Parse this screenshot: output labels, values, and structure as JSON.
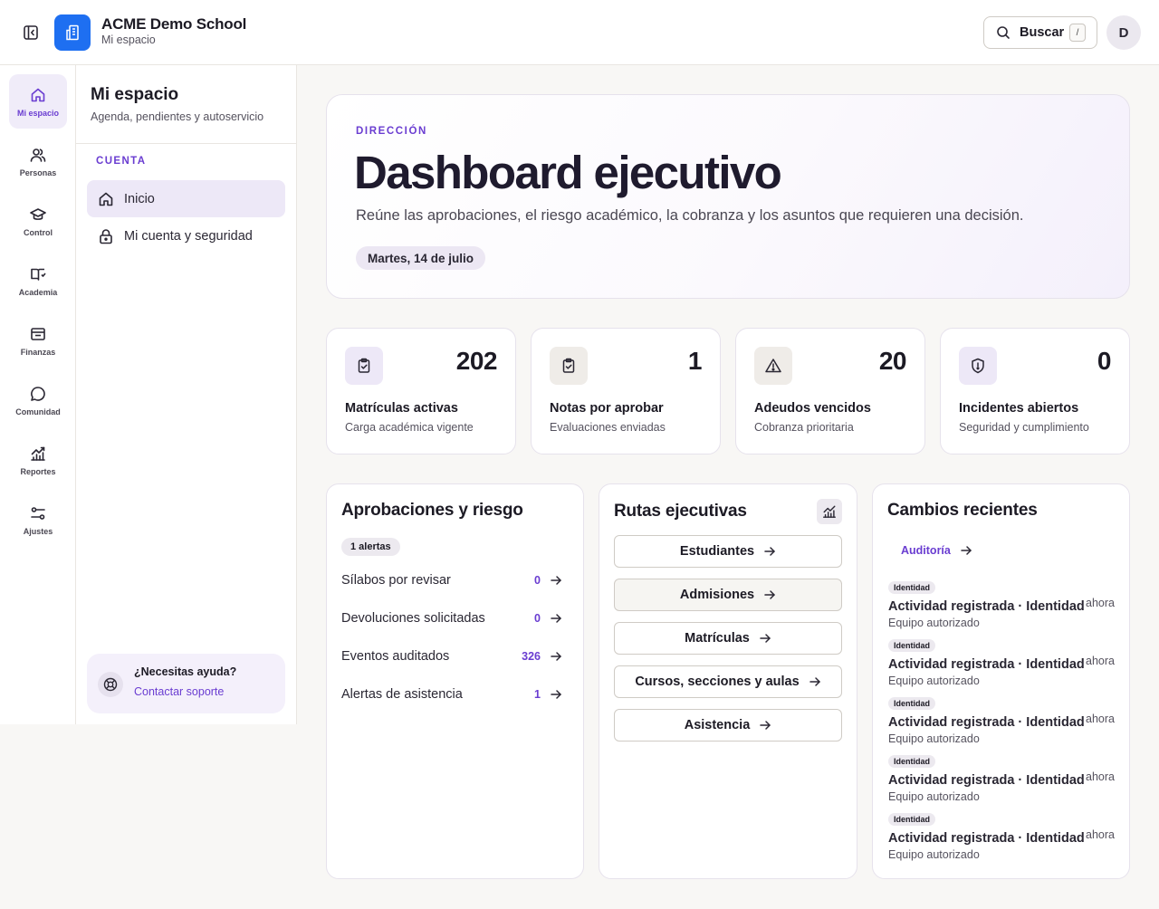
{
  "app": {
    "name": "ACME Demo School",
    "subtitle": "Mi espacio"
  },
  "search": {
    "label": "Buscar",
    "shortcut": "/"
  },
  "user": {
    "avatar_initial": "D"
  },
  "rail": [
    {
      "label": "Mi espacio",
      "icon": "home-icon",
      "active": true
    },
    {
      "label": "Personas",
      "icon": "users-icon"
    },
    {
      "label": "Control",
      "icon": "graduation-cap-icon"
    },
    {
      "label": "Academia",
      "icon": "book-icon"
    },
    {
      "label": "Finanzas",
      "icon": "wallet-icon"
    },
    {
      "label": "Comunidad",
      "icon": "chat-bubble-icon"
    },
    {
      "label": "Reportes",
      "icon": "chart-icon"
    },
    {
      "label": "Ajustes",
      "icon": "sliders-icon"
    }
  ],
  "subnav": {
    "title": "Mi espacio",
    "subtitle": "Agenda, pendientes y autoservicio",
    "section": "CUENTA",
    "items": [
      {
        "label": "Inicio",
        "icon": "home-icon",
        "active": true
      },
      {
        "label": "Mi cuenta y seguridad",
        "icon": "lock-icon"
      }
    ],
    "help": {
      "title": "¿Necesitas ayuda?",
      "link": "Contactar soporte"
    }
  },
  "hero": {
    "kicker": "DIRECCIÓN",
    "title": "Dashboard ejecutivo",
    "description": "Reúne las aprobaciones, el riesgo académico, la cobranza y los asuntos que requieren una decisión.",
    "date": "Martes, 14 de julio"
  },
  "stats": [
    {
      "value": "202",
      "label": "Matrículas activas",
      "sub": "Carga académica vigente",
      "icon": "clipboard-check-icon",
      "bg": "#ede8f7"
    },
    {
      "value": "1",
      "label": "Notas por aprobar",
      "sub": "Evaluaciones enviadas",
      "icon": "clipboard-check-icon",
      "bg": "#efece8"
    },
    {
      "value": "20",
      "label": "Adeudos vencidos",
      "sub": "Cobranza prioritaria",
      "icon": "alert-triangle-icon",
      "bg": "#efece8"
    },
    {
      "value": "0",
      "label": "Incidentes abiertos",
      "sub": "Seguridad y cumplimiento",
      "icon": "shield-icon",
      "bg": "#ede8f7"
    }
  ],
  "approvals": {
    "title": "Aprobaciones y riesgo",
    "badge": "1 alertas",
    "rows": [
      {
        "label": "Sílabos por revisar",
        "value": "0"
      },
      {
        "label": "Devoluciones solicitadas",
        "value": "0"
      },
      {
        "label": "Eventos auditados",
        "value": "326"
      },
      {
        "label": "Alertas de asistencia",
        "value": "1"
      }
    ]
  },
  "routes": {
    "title": "Rutas ejecutivas",
    "items": [
      "Estudiantes",
      "Admisiones",
      "Matrículas",
      "Cursos, secciones y aulas",
      "Asistencia"
    ]
  },
  "changes": {
    "title": "Cambios recientes",
    "link": "Auditoría",
    "items": [
      {
        "tag": "Identidad",
        "title": "Actividad registrada · Identidad",
        "time": "ahora",
        "sub": "Equipo autorizado"
      },
      {
        "tag": "Identidad",
        "title": "Actividad registrada · Identidad",
        "time": "ahora",
        "sub": "Equipo autorizado"
      },
      {
        "tag": "Identidad",
        "title": "Actividad registrada · Identidad",
        "time": "ahora",
        "sub": "Equipo autorizado"
      },
      {
        "tag": "Identidad",
        "title": "Actividad registrada · Identidad",
        "time": "ahora",
        "sub": "Equipo autorizado"
      },
      {
        "tag": "Identidad",
        "title": "Actividad registrada · Identidad",
        "time": "ahora",
        "sub": "Equipo autorizado"
      }
    ]
  },
  "colors": {
    "accent": "#6a3dd1",
    "brand": "#1e6ff1"
  }
}
